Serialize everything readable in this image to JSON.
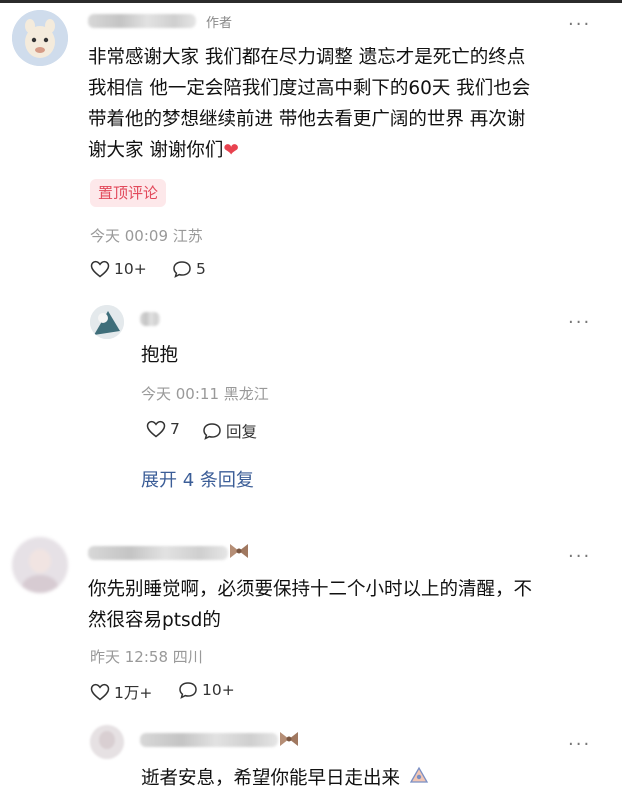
{
  "comment1": {
    "author_tag": "作者",
    "text_lines": [
      "非常感谢大家 我们都在尽力调整 遗忘才是死亡的终点",
      "我相信 他一定会陪我们度过高中剩下的60天 我们也会",
      "带着他的梦想继续前进 带他去看更广阔的世界 再次谢",
      "谢大家 谢谢你们"
    ],
    "heart_emoji": "❤",
    "pinned_label": "置顶评论",
    "time": "今天 00:09",
    "location": "江苏",
    "likes": "10+",
    "replies": "5",
    "more": "···"
  },
  "reply1": {
    "text": "抱抱",
    "time": "今天 00:11",
    "location": "黑龙江",
    "likes": "7",
    "reply_label": "回复",
    "more": "···"
  },
  "expand_label": "展开 4 条回复",
  "comment2": {
    "text_lines": [
      "你先别睡觉啊，必须要保持十二个小时以上的清醒，不",
      "然很容易ptsd的"
    ],
    "time": "昨天 12:58",
    "location": "四川",
    "likes": "1万+",
    "replies": "10+",
    "more": "···"
  },
  "reply2": {
    "text": "逝者安息，希望你能早日走出来",
    "more": "···"
  },
  "colors": {
    "pin_bg": "#fde8ea",
    "pin_text": "#e2495b",
    "link": "#3b5d97",
    "meta": "#999999"
  },
  "icons": [
    "heart-outline-icon",
    "comment-bubble-icon",
    "more-dots-icon"
  ]
}
